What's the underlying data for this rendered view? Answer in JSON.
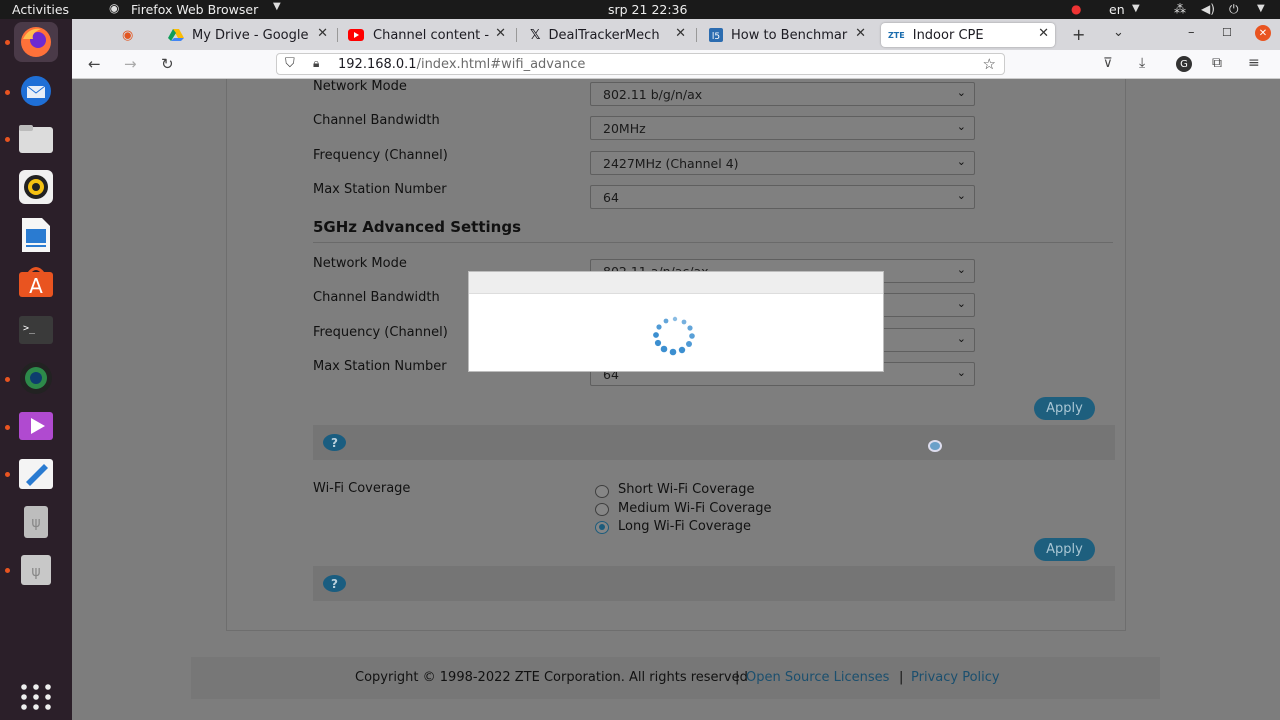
{
  "topbar": {
    "activities": "Activities",
    "app_menu": "Firefox Web Browser",
    "clock": "srp 21  22:36",
    "lang": "en"
  },
  "browser": {
    "tabs": [
      {
        "label": ""
      },
      {
        "label": "My Drive - Google"
      },
      {
        "label": "Channel content -"
      },
      {
        "label": "DealTrackerMech"
      },
      {
        "label": "How to Benchmar"
      },
      {
        "label": "Indoor CPE"
      }
    ],
    "url_host": "192.168.0.1",
    "url_path": "/index.html#wifi_advance"
  },
  "settings_24": {
    "network_mode_label": "Network Mode",
    "network_mode_value": "802.11 b/g/n/ax",
    "bandwidth_label": "Channel Bandwidth",
    "bandwidth_value": "20MHz",
    "frequency_label": "Frequency (Channel)",
    "frequency_value": "2427MHz (Channel 4)",
    "max_station_label": "Max Station Number",
    "max_station_value": "64"
  },
  "settings_5": {
    "title": "5GHz Advanced Settings",
    "network_mode_label": "Network Mode",
    "network_mode_value": "802.11 a/n/ac/ax",
    "bandwidth_label": "Channel Bandwidth",
    "frequency_label": "Frequency (Channel)",
    "max_station_label": "Max Station Number",
    "max_station_value": "64",
    "apply": "Apply"
  },
  "coverage": {
    "label": "Wi-Fi Coverage",
    "options": [
      "Short Wi-Fi Coverage",
      "Medium Wi-Fi Coverage",
      "Long Wi-Fi Coverage"
    ],
    "selected": "Long Wi-Fi Coverage",
    "apply": "Apply"
  },
  "help_glyph": "?",
  "footer": {
    "copyright": "Copyright © 1998-2022 ZTE Corporation. All rights reserved",
    "sep": "|",
    "open_source": "Open Source Licenses",
    "privacy": "Privacy Policy"
  },
  "colors": {
    "accent": "#1e5f7e",
    "spinner": "#3c8fd0",
    "ubuntu_orange": "#e95420"
  }
}
